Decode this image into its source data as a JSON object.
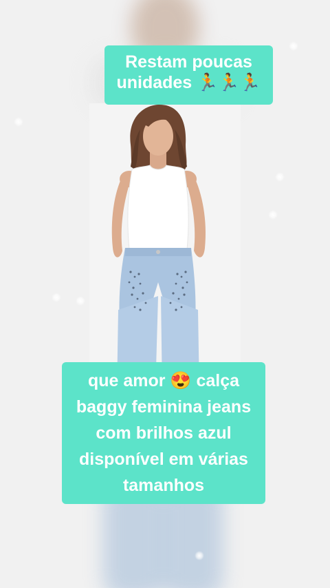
{
  "overlay": {
    "top_caption": {
      "line1": "Restam poucas",
      "line2": "unidades 🏃🏃🏃"
    },
    "bottom_caption": {
      "line1": "que amor 😍 calça",
      "line2": "baggy feminina jeans",
      "line3": "com brilhos azul",
      "line4": "disponível em várias",
      "line5": "tamanhos"
    }
  },
  "colors": {
    "caption_bg": "#5ce3c9",
    "caption_text": "#ffffff",
    "background": "#f1f1f1",
    "jeans": "#aac4e0",
    "top": "#ffffff",
    "hair": "#6e4631"
  },
  "product": {
    "image": "model-wearing-white-tank-top-and-light-blue-rhinestone-baggy-jeans"
  }
}
